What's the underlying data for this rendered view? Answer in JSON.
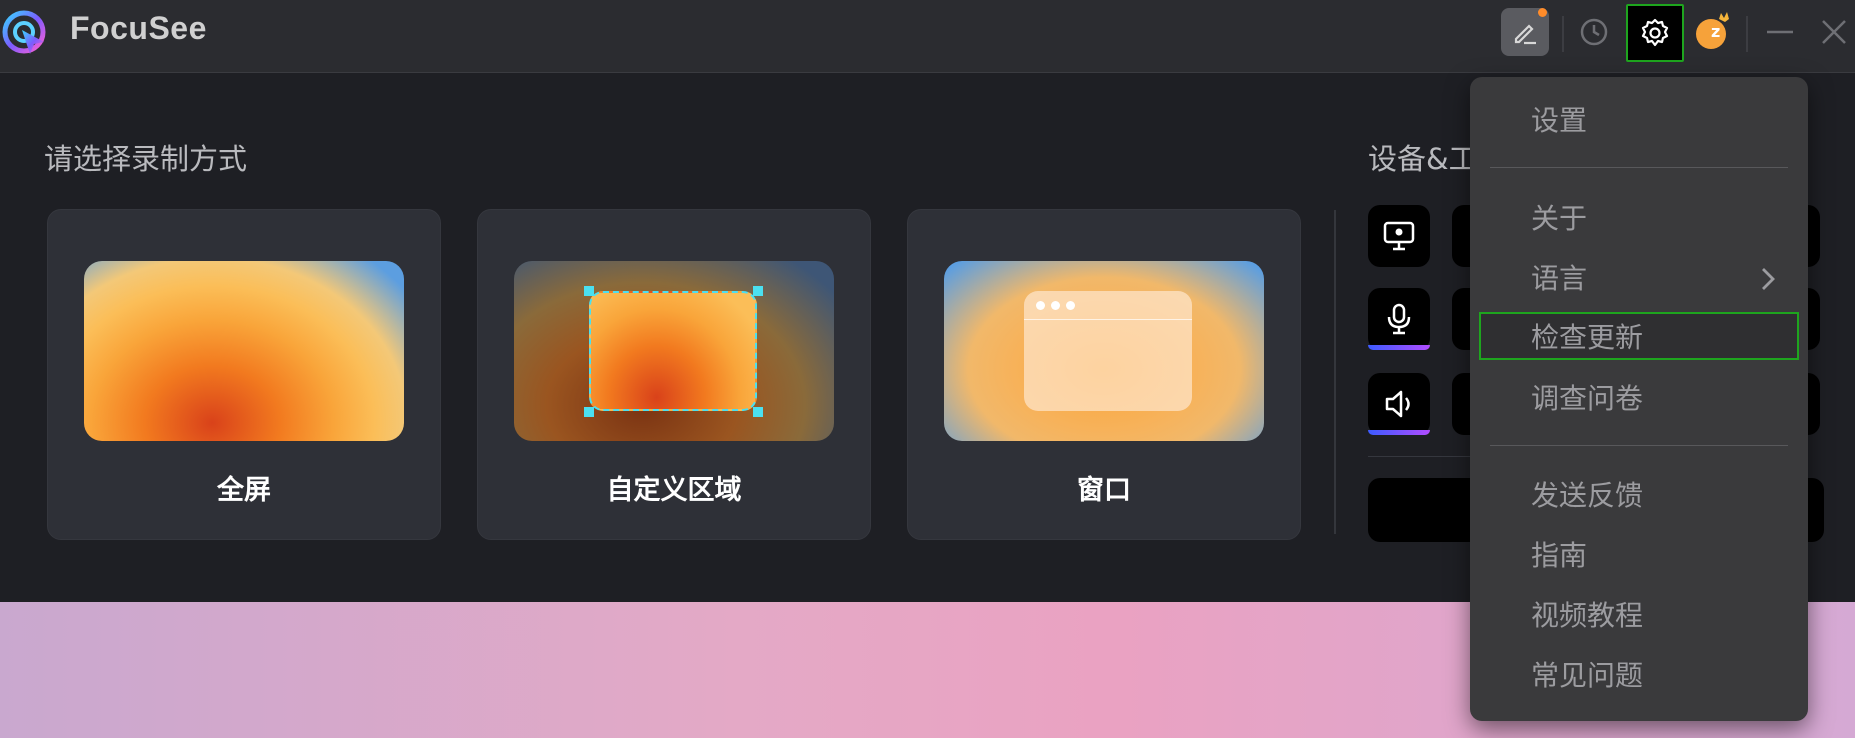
{
  "app": {
    "name": "FocuSee"
  },
  "titlebar": {
    "icons": [
      "edit-icon",
      "history-icon",
      "settings-icon",
      "avatar-icon",
      "minimize-icon",
      "close-icon"
    ],
    "avatar_letter": "z",
    "accent": "#ff8c2a"
  },
  "main": {
    "record_title": "请选择录制方式",
    "devices_title": "设备&工",
    "modes": [
      {
        "label": "全屏"
      },
      {
        "label": "自定义区域"
      },
      {
        "label": "窗口"
      }
    ]
  },
  "menu": {
    "items": [
      {
        "label": "设置"
      },
      {
        "label": "关于"
      },
      {
        "label": "语言"
      },
      {
        "label": "检查更新"
      },
      {
        "label": "调查问卷"
      },
      {
        "label": "发送反馈"
      },
      {
        "label": "指南"
      },
      {
        "label": "视频教程"
      },
      {
        "label": "常见问题"
      }
    ],
    "highlight_color": "#1ea51e"
  }
}
